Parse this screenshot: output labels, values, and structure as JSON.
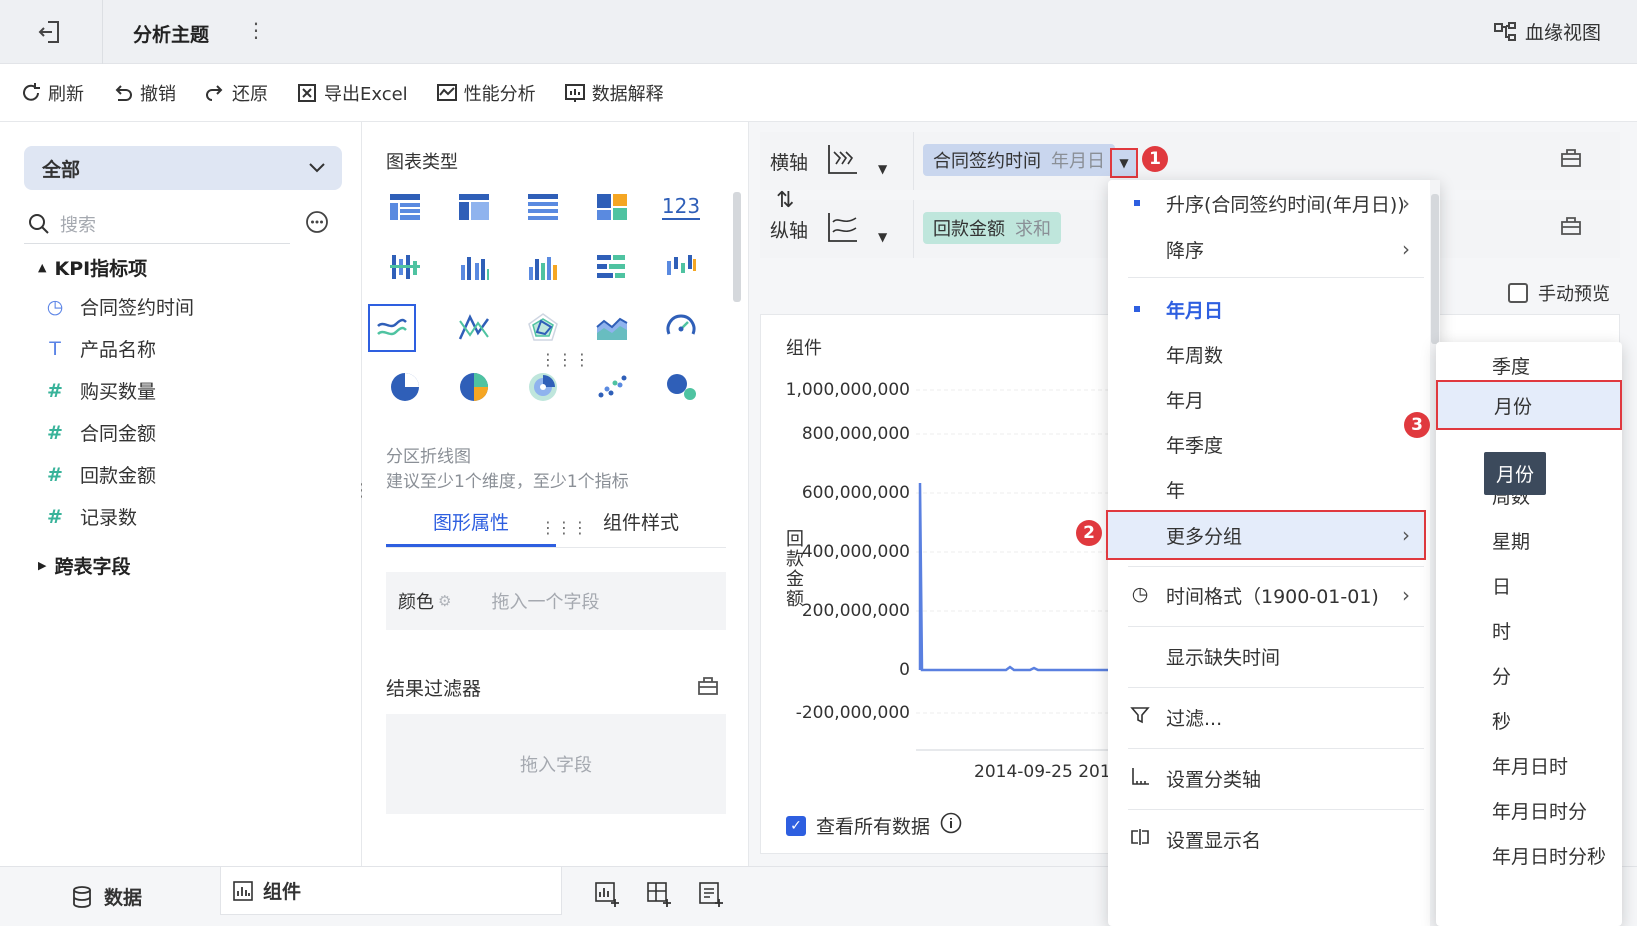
{
  "header": {
    "title": "分析主题",
    "lineage_label": "血缘视图"
  },
  "toolbar": {
    "items": [
      {
        "label": "刷新",
        "icon": "refresh-icon"
      },
      {
        "label": "撤销",
        "icon": "undo-icon"
      },
      {
        "label": "还原",
        "icon": "redo-icon"
      },
      {
        "label": "导出Excel",
        "icon": "excel-icon"
      },
      {
        "label": "性能分析",
        "icon": "performance-icon"
      },
      {
        "label": "数据解释",
        "icon": "explain-icon"
      }
    ]
  },
  "left": {
    "scope": "全部",
    "search_placeholder": "搜索",
    "group1": "KPI指标项",
    "fields": [
      {
        "label": "合同签约时间",
        "type": "date"
      },
      {
        "label": "产品名称",
        "type": "text"
      },
      {
        "label": "购买数量",
        "type": "number"
      },
      {
        "label": "合同金额",
        "type": "number"
      },
      {
        "label": "回款金额",
        "type": "number"
      },
      {
        "label": "记录数",
        "type": "number"
      }
    ],
    "group2": "跨表字段"
  },
  "middle": {
    "chart_type_title": "图表类型",
    "chart_name": "分区折线图",
    "chart_hint": "建议至少1个维度，至少1个指标",
    "tabs": [
      "图形属性",
      "组件样式"
    ],
    "color_label": "颜色",
    "color_placeholder": "拖入一个字段",
    "filter_title": "结果过滤器",
    "filter_placeholder": "拖入字段",
    "icon_123": "123"
  },
  "axes": {
    "x_label": "横轴",
    "x_field": "合同签约时间",
    "x_sub": "年月日",
    "y_label": "纵轴",
    "y_field": "回款金额",
    "y_sub": "求和",
    "manual_preview": "手动预览"
  },
  "chart": {
    "component_title": "组件",
    "y_ticks": [
      "1,000,000,000",
      "800,000,000",
      "600,000,000",
      "400,000,000",
      "200,000,000",
      "0",
      "-200,000,000"
    ],
    "y_label": "回款金额",
    "x_tick": "2014-09-25",
    "x_tick_partial": "201",
    "view_all": "查看所有数据"
  },
  "menu": {
    "items": [
      "升序(合同签约时间(年月日))",
      "降序",
      "年月日",
      "年周数",
      "年月",
      "年季度",
      "年",
      "更多分组",
      "时间格式（1900-01-01)",
      "显示缺失时间",
      "过滤...",
      "设置分类轴",
      "设置显示名"
    ]
  },
  "submenu": {
    "items": [
      "季度",
      "月份",
      "周数",
      "星期",
      "日",
      "时",
      "分",
      "秒",
      "年月日时",
      "年月日时分",
      "年月日时分秒"
    ],
    "tooltip": "月份"
  },
  "badges": [
    "1",
    "2",
    "3"
  ],
  "bottom": {
    "data_tab": "数据",
    "component_tab": "组件"
  },
  "colors": {
    "accent": "#2e5fe0",
    "highlight": "#e0393e",
    "x_pill": "#c9d6ee",
    "y_pill": "#bfe6dc"
  }
}
